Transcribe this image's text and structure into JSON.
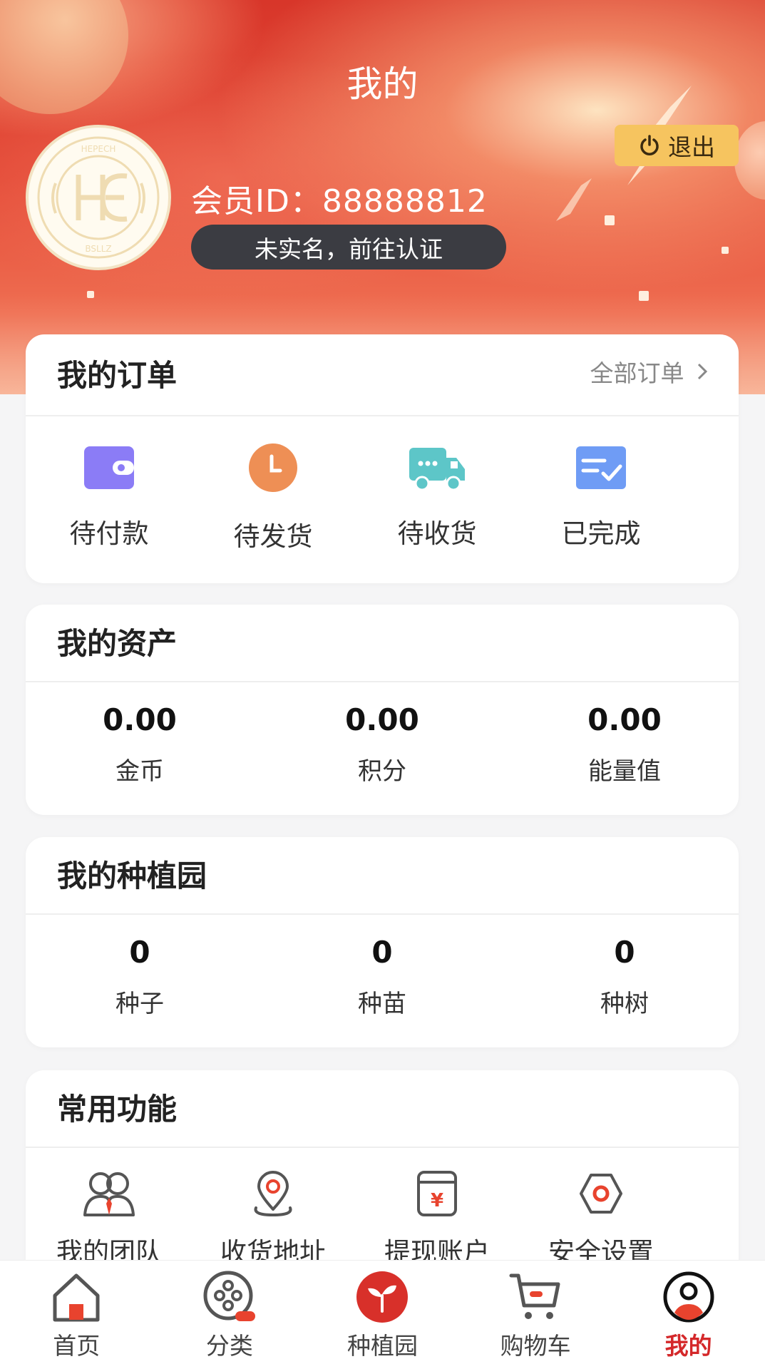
{
  "header": {
    "title": "我的",
    "member_id": "会员ID：88888812",
    "verify_label": "未实名，前往认证",
    "logout_label": "退出",
    "logo_text_top": "HEPECH",
    "logo_text_bottom": "BSLLZ"
  },
  "orders": {
    "title": "我的订单",
    "all_link": "全部订单",
    "items": [
      {
        "label": "待付款",
        "icon": "wallet-icon"
      },
      {
        "label": "待发货",
        "icon": "clock-icon"
      },
      {
        "label": "待收货",
        "icon": "truck-icon"
      },
      {
        "label": "已完成",
        "icon": "completed-icon"
      }
    ]
  },
  "assets": {
    "title": "我的资产",
    "items": [
      {
        "value": "0.00",
        "label": "金币"
      },
      {
        "value": "0.00",
        "label": "积分"
      },
      {
        "value": "0.00",
        "label": "能量值"
      }
    ]
  },
  "garden": {
    "title": "我的种植园",
    "items": [
      {
        "value": "0",
        "label": "种子"
      },
      {
        "value": "0",
        "label": "种苗"
      },
      {
        "value": "0",
        "label": "种树"
      }
    ]
  },
  "functions": {
    "title": "常用功能",
    "items": [
      {
        "label": "我的团队",
        "icon": "team-icon"
      },
      {
        "label": "收货地址",
        "icon": "location-icon"
      },
      {
        "label": "提现账户",
        "icon": "withdraw-icon"
      },
      {
        "label": "安全设置",
        "icon": "security-icon"
      }
    ]
  },
  "tabbar": {
    "items": [
      {
        "label": "首页",
        "icon": "home-icon"
      },
      {
        "label": "分类",
        "icon": "category-icon"
      },
      {
        "label": "种植园",
        "icon": "sprout-icon"
      },
      {
        "label": "购物车",
        "icon": "cart-icon"
      },
      {
        "label": "我的",
        "icon": "profile-icon",
        "active": true
      }
    ]
  },
  "colors": {
    "accent_red": "#d4282a",
    "logout_yellow": "#f6c45f",
    "verify_dark": "#3b3c42"
  }
}
